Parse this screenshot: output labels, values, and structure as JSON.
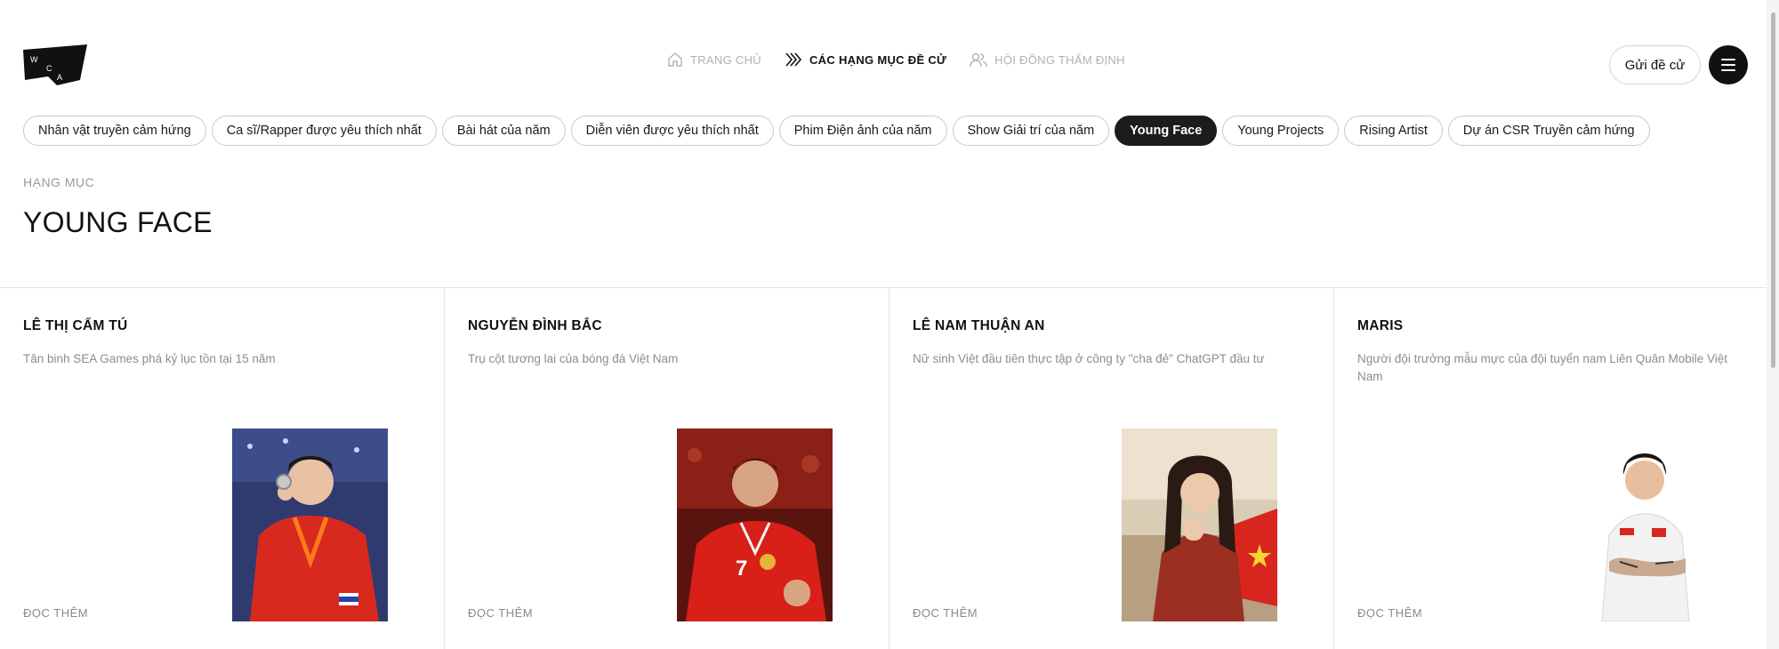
{
  "brand": {
    "logo_letters": [
      "W",
      "C",
      "A"
    ]
  },
  "nav": {
    "items": [
      {
        "label": "TRANG CHỦ",
        "icon": "home-icon",
        "active": false
      },
      {
        "label": "CÁC HẠNG MỤC ĐỀ CỬ",
        "icon": "chevrons-icon",
        "active": true
      },
      {
        "label": "HỘI ĐỒNG THẨM ĐỊNH",
        "icon": "users-icon",
        "active": false
      }
    ]
  },
  "header": {
    "submit_label": "Gửi đề cử",
    "menu_icon": "hamburger-icon"
  },
  "categories": [
    {
      "label": "Nhân vật truyền cảm hứng",
      "active": false
    },
    {
      "label": "Ca sĩ/Rapper được yêu thích nhất",
      "active": false
    },
    {
      "label": "Bài hát của năm",
      "active": false
    },
    {
      "label": "Diễn viên được yêu thích nhất",
      "active": false
    },
    {
      "label": "Phim Điện ảnh của năm",
      "active": false
    },
    {
      "label": "Show Giải trí của năm",
      "active": false
    },
    {
      "label": "Young Face",
      "active": true
    },
    {
      "label": "Young Projects",
      "active": false
    },
    {
      "label": "Rising Artist",
      "active": false
    },
    {
      "label": "Dự án CSR Truyền cảm hứng",
      "active": false
    }
  ],
  "page": {
    "section_label": "HẠNG MỤC",
    "title": "YOUNG FACE"
  },
  "cards": [
    {
      "name": "LÊ THỊ CẨM TÚ",
      "description": "Tân binh SEA Games phá kỷ lục tồn tại 15 năm",
      "more_label": "ĐỌC THÊM",
      "photo": "athlete-red-jersey-medal"
    },
    {
      "name": "NGUYỄN ĐÌNH BẮC",
      "description": "Trụ cột tương lai của bóng đá Việt Nam",
      "more_label": "ĐỌC THÊM",
      "photo": "footballer-red-jersey-medal"
    },
    {
      "name": "LÊ NAM THUẬN AN",
      "description": "Nữ sinh Việt đầu tiên thực tập ở công ty \"cha đẻ\" ChatGPT đầu tư",
      "more_label": "ĐỌC THÊM",
      "photo": "student-red-dress-flag"
    },
    {
      "name": "MARIS",
      "description": "Người đội trưởng mẫu mực của đội tuyển nam Liên Quân Mobile Việt Nam",
      "more_label": "ĐỌC THÊM",
      "photo": "esports-player-white-jersey"
    }
  ],
  "colors": {
    "text": "#111111",
    "muted": "#9a9a9a",
    "active_chip": "#1c1c1c",
    "border": "#e5e5e5"
  }
}
